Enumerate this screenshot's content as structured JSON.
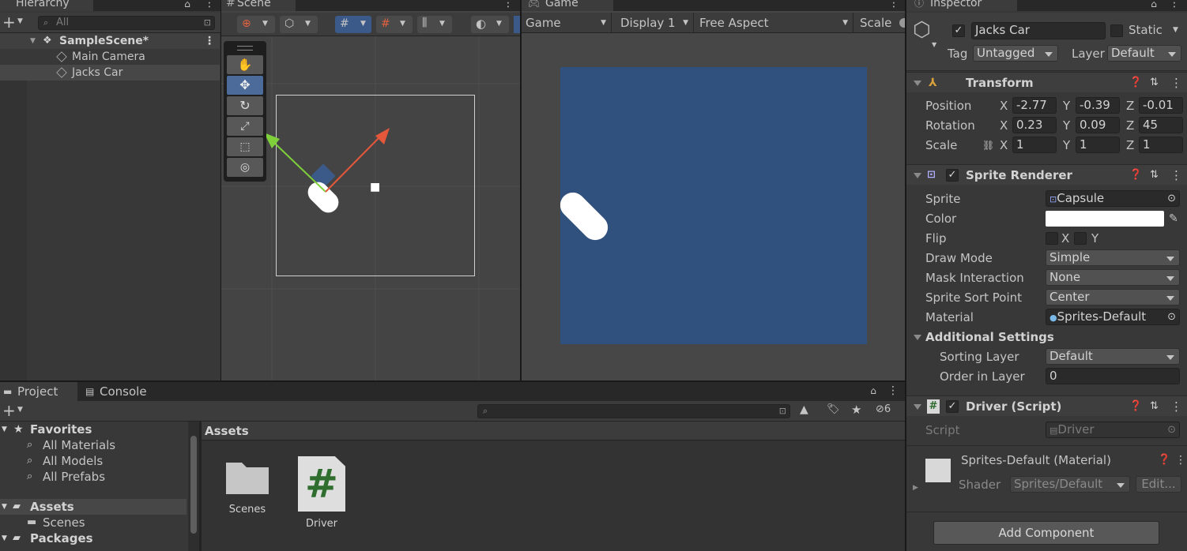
{
  "hierarchy": {
    "tab": "Hierarchy",
    "search_placeholder": "All",
    "scene": "SampleScene*",
    "items": [
      "Main Camera",
      "Jacks Car"
    ]
  },
  "scene": {
    "tab": "Scene"
  },
  "game": {
    "tab": "Game",
    "mode": "Game",
    "display": "Display 1",
    "aspect": "Free Aspect",
    "scale_label": "Scale",
    "background_color": "#30507e"
  },
  "inspector": {
    "tab": "Inspector",
    "object_name": "Jacks Car",
    "static_label": "Static",
    "tag_label": "Tag",
    "tag_value": "Untagged",
    "layer_label": "Layer",
    "layer_value": "Default",
    "transform": {
      "title": "Transform",
      "rows": [
        {
          "label": "Position",
          "x": "-2.77",
          "y": "-0.39",
          "z": "-0.01"
        },
        {
          "label": "Rotation",
          "x": "0.23",
          "y": "0.09",
          "z": "45"
        },
        {
          "label": "Scale",
          "x": "1",
          "y": "1",
          "z": "1"
        }
      ],
      "axis_x": "X",
      "axis_y": "Y",
      "axis_z": "Z"
    },
    "sprite_renderer": {
      "title": "Sprite Renderer",
      "sprite_label": "Sprite",
      "sprite_value": "Capsule",
      "color_label": "Color",
      "color_value": "#ffffff",
      "flip_label": "Flip",
      "flip_x": "X",
      "flip_y": "Y",
      "draw_mode_label": "Draw Mode",
      "draw_mode_value": "Simple",
      "mask_label": "Mask Interaction",
      "mask_value": "None",
      "sort_point_label": "Sprite Sort Point",
      "sort_point_value": "Center",
      "material_label": "Material",
      "material_value": "Sprites-Default",
      "additional": "Additional Settings",
      "sorting_layer_label": "Sorting Layer",
      "sorting_layer_value": "Default",
      "order_label": "Order in Layer",
      "order_value": "0"
    },
    "driver": {
      "title": "Driver (Script)",
      "script_label": "Script",
      "script_value": "Driver"
    },
    "material": {
      "title": "Sprites-Default (Material)",
      "shader_label": "Shader",
      "shader_value": "Sprites/Default",
      "edit_label": "Edit..."
    },
    "add_component": "Add Component"
  },
  "project": {
    "tab_project": "Project",
    "tab_console": "Console",
    "hidden_count": "6",
    "favorites": "Favorites",
    "fav_items": [
      "All Materials",
      "All Models",
      "All Prefabs"
    ],
    "assets": "Assets",
    "asset_children": [
      "Scenes"
    ],
    "packages": "Packages",
    "breadcrumb": "Assets",
    "grid_items": [
      "Scenes",
      "Driver"
    ]
  }
}
